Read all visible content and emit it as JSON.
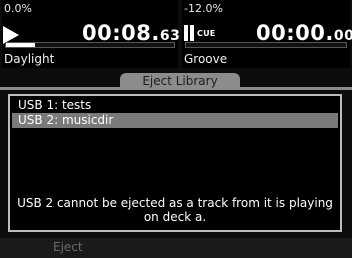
{
  "deck_a": {
    "pitch": "0.0%",
    "time_main": "00:08.",
    "time_frac": "63",
    "track": "Daylight",
    "progress_fraction": 0.17,
    "state_icon": "play-icon"
  },
  "deck_b": {
    "pitch": "-12.0%",
    "cue_label": "CUE",
    "time_main": "00:00.",
    "time_frac": "00",
    "track": "Groove",
    "progress_fraction": 0.0,
    "state_icon": "cue-icon"
  },
  "tab": {
    "label": "Eject Library"
  },
  "list": {
    "items": [
      {
        "label": "USB 1: tests"
      },
      {
        "label": "USB 2: musicdir"
      }
    ],
    "selected_index": 1
  },
  "message": "USB 2 cannot be ejected as a track from it is playing on deck a.",
  "footer": {
    "eject_label": "Eject"
  },
  "colors": {
    "background": "#0c0c0c",
    "selection": "#7a7a7a",
    "tab": "#8c8c8c",
    "disabled_text": "#6a6a6a"
  }
}
